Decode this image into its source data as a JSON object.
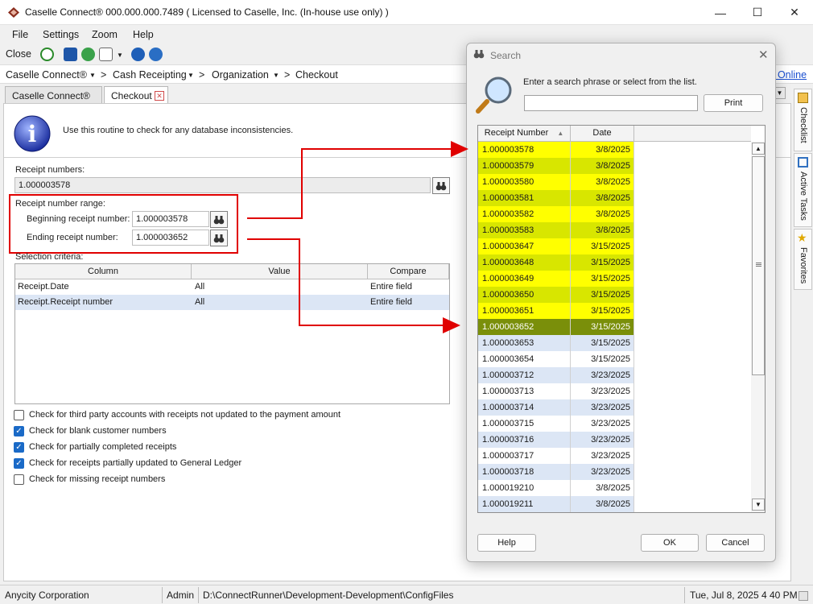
{
  "window": {
    "title": "Caselle Connect® 000.000.000.7489    ( Licensed to Caselle, Inc. (In-house use only) )",
    "minimize": "—",
    "maximize": "☐",
    "close": "✕"
  },
  "menu": [
    "File",
    "Settings",
    "Zoom",
    "Help"
  ],
  "toolbar": {
    "close_label": "Close"
  },
  "breadcrumb": [
    "Caselle Connect®",
    "Cash Receipting",
    "Organization",
    "Checkout"
  ],
  "breadcrumb_sep": ">",
  "online_link": "t Online",
  "tabs": [
    "Caselle Connect®",
    "Checkout"
  ],
  "main": {
    "info_text": "Use this routine to check for any database inconsistencies.",
    "receipt_numbers_label": "Receipt numbers:",
    "receipt_numbers_value": "1.000003578",
    "range_label": "Receipt number range:",
    "beginning_label": "Beginning receipt number:",
    "beginning_value": "1.000003578",
    "ending_label": "Ending receipt number:",
    "ending_value": "1.000003652",
    "selection_label": "Selection criteria:",
    "criteria_headers": [
      "Column",
      "Value",
      "Compare"
    ],
    "criteria_rows": [
      {
        "column": "Receipt.Date",
        "value": "All",
        "compare": "Entire field"
      },
      {
        "column": "Receipt.Receipt number",
        "value": "All",
        "compare": "Entire field"
      }
    ],
    "checks": [
      {
        "label": "Check for third party accounts with receipts not updated to the payment amount",
        "checked": false
      },
      {
        "label": "Check for blank customer numbers",
        "checked": true
      },
      {
        "label": "Check for partially completed receipts",
        "checked": true
      },
      {
        "label": "Check for receipts partially updated to General Ledger",
        "checked": true
      },
      {
        "label": "Check for missing receipt numbers",
        "checked": false
      }
    ]
  },
  "side_tabs": [
    "Checklist",
    "Active Tasks",
    "Favorites"
  ],
  "status": {
    "org": "Anycity Corporation",
    "user": "Admin",
    "path": "D:\\ConnectRunner\\Development-Development\\ConfigFiles",
    "datetime": "Tue, Jul 8, 2025 4 40 PM"
  },
  "dialog": {
    "title": "Search",
    "prompt": "Enter a search phrase or select from the list.",
    "search_value": "",
    "print_label": "Print",
    "col_headers": [
      "Receipt Number",
      "Date"
    ],
    "rows": [
      {
        "num": "1.000003578",
        "date": "3/8/2025",
        "state": "hl"
      },
      {
        "num": "1.000003579",
        "date": "3/8/2025",
        "state": "hl"
      },
      {
        "num": "1.000003580",
        "date": "3/8/2025",
        "state": "hl"
      },
      {
        "num": "1.000003581",
        "date": "3/8/2025",
        "state": "hl"
      },
      {
        "num": "1.000003582",
        "date": "3/8/2025",
        "state": "hl"
      },
      {
        "num": "1.000003583",
        "date": "3/8/2025",
        "state": "hl"
      },
      {
        "num": "1.000003647",
        "date": "3/15/2025",
        "state": "hl"
      },
      {
        "num": "1.000003648",
        "date": "3/15/2025",
        "state": "hl"
      },
      {
        "num": "1.000003649",
        "date": "3/15/2025",
        "state": "hl"
      },
      {
        "num": "1.000003650",
        "date": "3/15/2025",
        "state": "hl"
      },
      {
        "num": "1.000003651",
        "date": "3/15/2025",
        "state": "hl"
      },
      {
        "num": "1.000003652",
        "date": "3/15/2025",
        "state": "sel"
      },
      {
        "num": "1.000003653",
        "date": "3/15/2025",
        "state": "n"
      },
      {
        "num": "1.000003654",
        "date": "3/15/2025",
        "state": "n"
      },
      {
        "num": "1.000003712",
        "date": "3/23/2025",
        "state": "n"
      },
      {
        "num": "1.000003713",
        "date": "3/23/2025",
        "state": "n"
      },
      {
        "num": "1.000003714",
        "date": "3/23/2025",
        "state": "n"
      },
      {
        "num": "1.000003715",
        "date": "3/23/2025",
        "state": "n"
      },
      {
        "num": "1.000003716",
        "date": "3/23/2025",
        "state": "n"
      },
      {
        "num": "1.000003717",
        "date": "3/23/2025",
        "state": "n"
      },
      {
        "num": "1.000003718",
        "date": "3/23/2025",
        "state": "n"
      },
      {
        "num": "1.000019210",
        "date": "3/8/2025",
        "state": "n"
      },
      {
        "num": "1.000019211",
        "date": "3/8/2025",
        "state": "n"
      }
    ],
    "help_label": "Help",
    "ok_label": "OK",
    "cancel_label": "Cancel"
  },
  "colors": {
    "highlight_a": "#ffff00",
    "highlight_b": "#d8e600",
    "selected": "#7a8f0a",
    "alt_row": "#dce6f5",
    "annotation": "#e00000",
    "checkbox": "#1a6ac7"
  }
}
